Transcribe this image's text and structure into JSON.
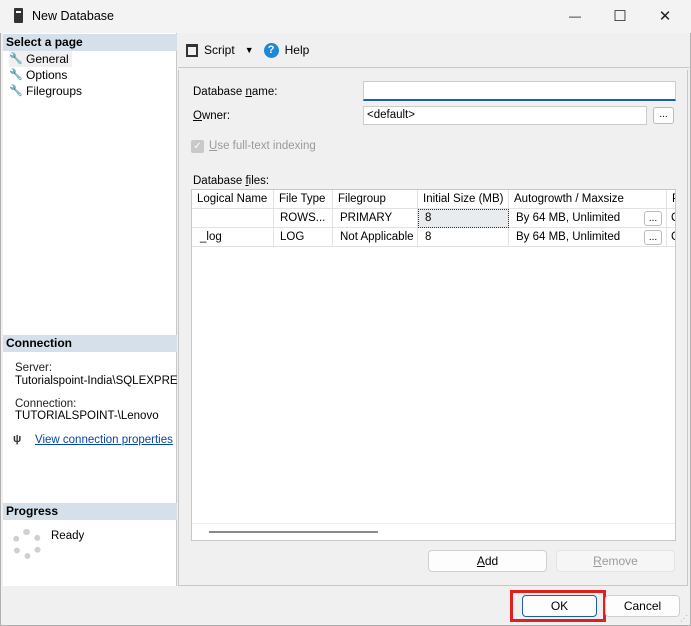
{
  "window": {
    "title": "New Database",
    "minimize": "—",
    "maximize": "☐",
    "close": "✕"
  },
  "sidebar": {
    "header": "Select a page",
    "items": [
      {
        "label": "General"
      },
      {
        "label": "Options"
      },
      {
        "label": "Filegroups"
      }
    ]
  },
  "connection": {
    "header": "Connection",
    "server_label": "Server:",
    "server": "Tutorialspoint-India\\SQLEXPRESS",
    "connection_label": "Connection:",
    "connection": "TUTORIALSPOINT-\\Lenovo",
    "link": "View connection properties"
  },
  "progress": {
    "header": "Progress",
    "status": "Ready"
  },
  "toolbar": {
    "script": "Script",
    "help": "Help"
  },
  "form": {
    "db_name_label_pre": "Database ",
    "db_name_label_u": "n",
    "db_name_label_post": "ame:",
    "db_name_value": "",
    "owner_label_u": "O",
    "owner_label_post": "wner:",
    "owner_value": "<default>",
    "browse": "...",
    "fulltext_u": "U",
    "fulltext_post": "se full-text indexing",
    "fulltext_checked": true,
    "files_label_pre": "Database ",
    "files_label_u": "f",
    "files_label_post": "iles:"
  },
  "grid": {
    "columns": [
      "Logical Name",
      "File Type",
      "Filegroup",
      "Initial Size (MB)",
      "Autogrowth / Maxsize",
      "P"
    ],
    "rows": [
      {
        "name": "",
        "type": "ROWS...",
        "filegroup": "PRIMARY",
        "size": "8",
        "autogrowth": "By 64 MB, Unlimited",
        "btn": "...",
        "extra": "C"
      },
      {
        "name": "_log",
        "type": "LOG",
        "filegroup": "Not Applicable",
        "size": "8",
        "autogrowth": "By 64 MB, Unlimited",
        "btn": "...",
        "extra": "C"
      }
    ]
  },
  "buttons": {
    "add_u": "A",
    "add_post": "dd",
    "remove_u": "R",
    "remove_post": "emove",
    "ok": "OK",
    "cancel": "Cancel"
  },
  "colors": {
    "highlight": "#e02020",
    "link": "#0645ad",
    "header": "#d5e0ea"
  }
}
